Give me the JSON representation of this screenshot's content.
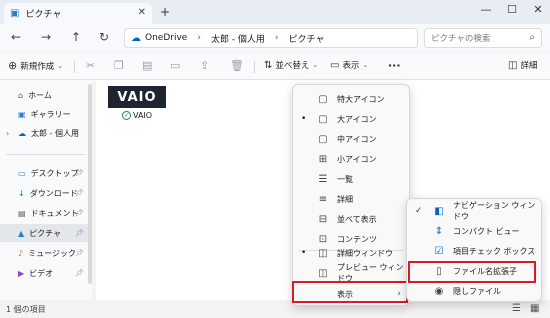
{
  "window": {
    "tab_title": "ピクチャ",
    "close_tab": "✕",
    "new_tab": "+",
    "minimize": "—",
    "maximize": "☐",
    "close": "✕"
  },
  "nav": {
    "back": "←",
    "forward": "→",
    "up": "↑",
    "refresh": "↻"
  },
  "address": {
    "crumbs": [
      "OneDrive",
      "太郎 - 個人用",
      "ピクチャ"
    ],
    "sep": "›"
  },
  "search": {
    "placeholder": "ピクチャの検索"
  },
  "toolbar": {
    "new_label": "新規作成",
    "sort_label": "並べ替え",
    "view_label": "表示",
    "more": "···",
    "details_label": "詳細"
  },
  "sidebar": {
    "top": [
      {
        "label": "ホーム",
        "icon": "⌂"
      },
      {
        "label": "ギャラリー",
        "icon": "▣"
      },
      {
        "label": "太郎 - 個人用",
        "icon": "☁"
      }
    ],
    "pinned": [
      {
        "label": "デスクトップ",
        "icon": "▭"
      },
      {
        "label": "ダウンロード",
        "icon": "↓"
      },
      {
        "label": "ドキュメント",
        "icon": "▤"
      },
      {
        "label": "ピクチャ",
        "icon": "▲"
      },
      {
        "label": "ミュージック",
        "icon": "♪"
      },
      {
        "label": "ビデオ",
        "icon": "▶"
      }
    ]
  },
  "content": {
    "thumb_text": "VAIO",
    "file_name": "VAIO",
    "sync_icon": "✓"
  },
  "status": {
    "count": "1 個の項目"
  },
  "view_menu": {
    "items": [
      {
        "label": "特大アイコン",
        "icon": "▢",
        "bullet": ""
      },
      {
        "label": "大アイコン",
        "icon": "▢",
        "bullet": "•"
      },
      {
        "label": "中アイコン",
        "icon": "▢",
        "bullet": ""
      },
      {
        "label": "小アイコン",
        "icon": "⊞",
        "bullet": ""
      },
      {
        "label": "一覧",
        "icon": "☰",
        "bullet": ""
      },
      {
        "label": "詳細",
        "icon": "≡",
        "bullet": ""
      },
      {
        "label": "並べて表示",
        "icon": "⊟",
        "bullet": ""
      },
      {
        "label": "コンテンツ",
        "icon": "⊡",
        "bullet": ""
      },
      {
        "label": "詳細ウィンドウ",
        "icon": "◫",
        "bullet": "•"
      },
      {
        "label": "プレビュー ウィンドウ",
        "icon": "◫",
        "bullet": ""
      },
      {
        "label": "表示",
        "icon": "",
        "bullet": "",
        "arrow": "›"
      }
    ]
  },
  "show_menu": {
    "items": [
      {
        "label": "ナビゲーション ウィンドウ",
        "icon": "◧",
        "check": "✓"
      },
      {
        "label": "コンパクト ビュー",
        "icon": "⇕",
        "check": ""
      },
      {
        "label": "項目チェック ボックス",
        "icon": "☑",
        "check": ""
      },
      {
        "label": "ファイル名拡張子",
        "icon": "▯",
        "check": ""
      },
      {
        "label": "隠しファイル",
        "icon": "◉",
        "check": ""
      }
    ]
  },
  "colors": {
    "highlight": "#d81b24",
    "accent": "#0067c0"
  }
}
